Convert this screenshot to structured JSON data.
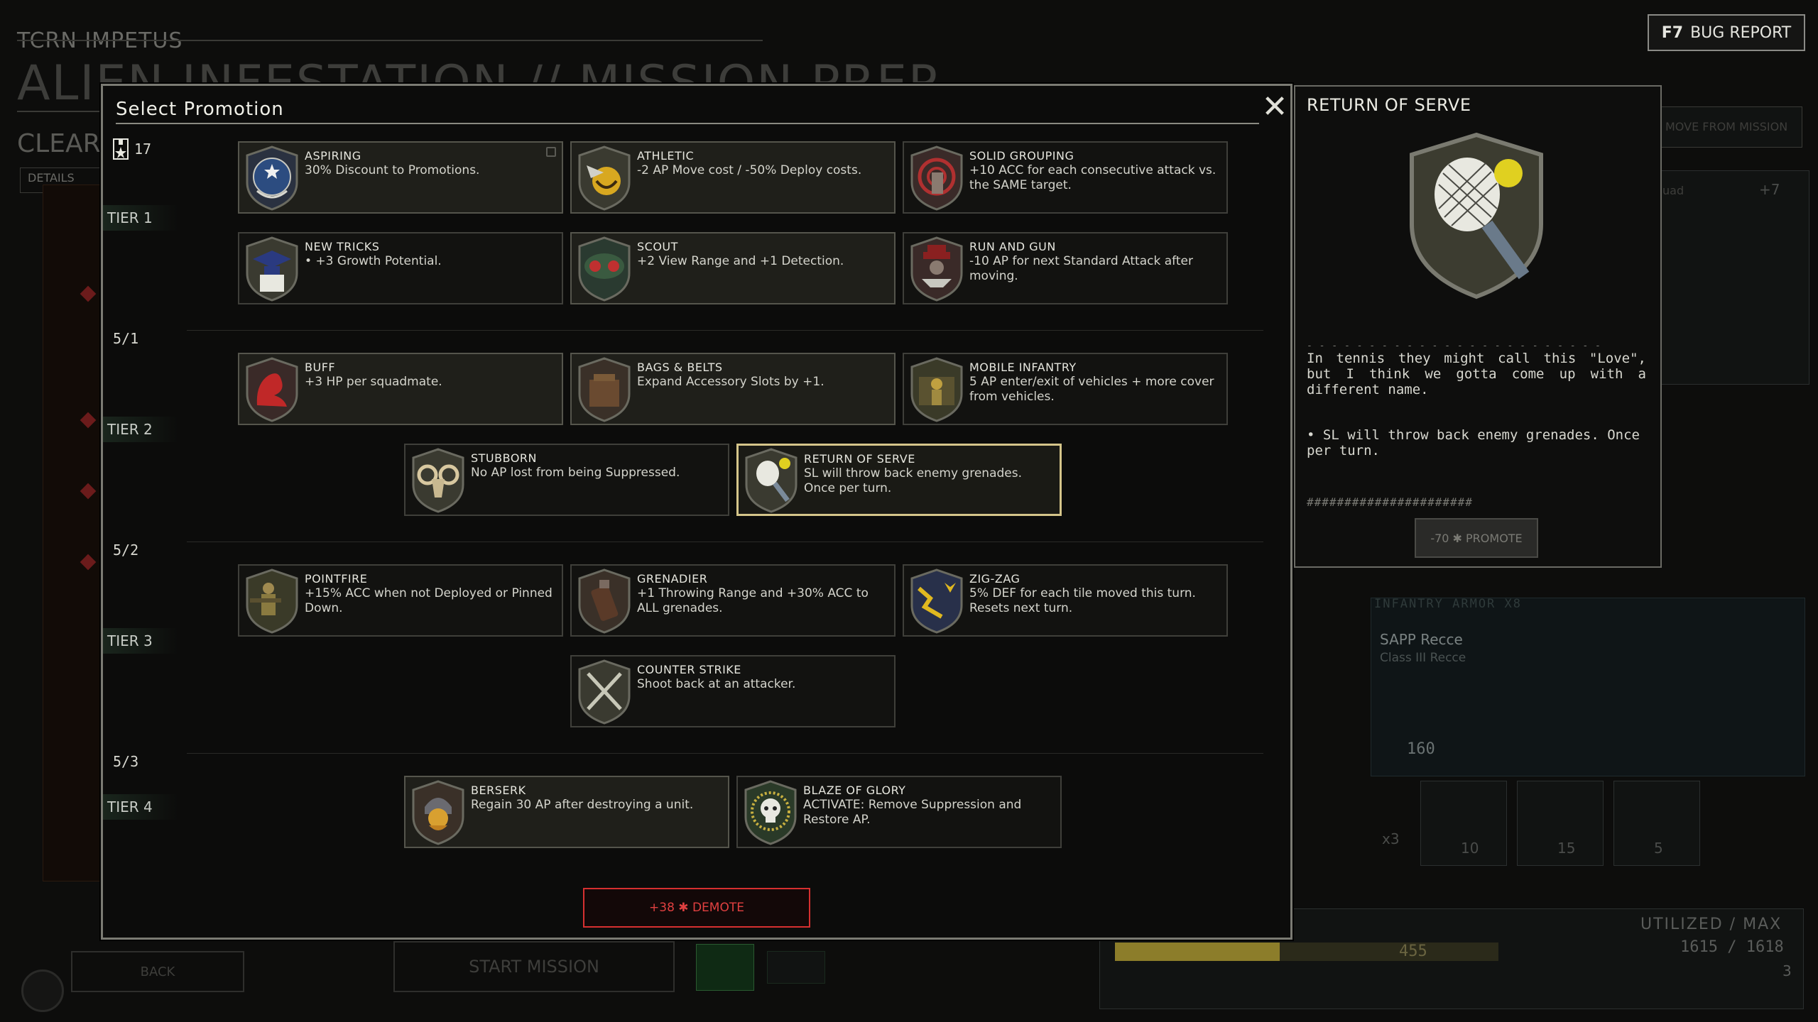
{
  "background": {
    "ship_name": "TCRN IMPETUS",
    "screen_title": "ALIEN INFESTATION // MISSION PREP",
    "clear_label": "CLEAR",
    "details_label": "DETAILS",
    "bug_report_key": "F7",
    "bug_report_label": "BUG REPORT",
    "remove_from_mission": "MOVE FROM MISSION",
    "squad_label": "uad",
    "squad_count": "+7",
    "armor_header": "INFANTRY ARMOR X8",
    "armor_name": "SAPP Recce",
    "armor_class": "Class III Recce",
    "armor_cost": "160",
    "item_costs": [
      "10",
      "15",
      "5"
    ],
    "x3_label": "x3",
    "utilized_label": "UTILIZED / MAX",
    "utilized_value": "1615 / 1618",
    "extra_value": "3",
    "bar_value": "455",
    "bar_fraction": 0.43,
    "back_label": "BACK",
    "start_mission_label": "START MISSION"
  },
  "modal": {
    "title": "Select Promotion",
    "close_label": "✕",
    "medal_count": "17",
    "tiers": {
      "tier1": "TIER 1",
      "tier2": "TIER 2",
      "tier3": "TIER 3",
      "tier4": "TIER 4"
    },
    "ranks": {
      "r1": "5/1",
      "r2": "5/2",
      "r3": "5/3"
    },
    "perks": {
      "aspiring": {
        "name": "ASPIRING",
        "desc": "30% Discount to Promotions."
      },
      "athletic": {
        "name": "ATHLETIC",
        "desc": "-2 AP Move cost / -50% Deploy costs."
      },
      "solid_grouping": {
        "name": "SOLID GROUPING",
        "desc": "+10 ACC for each consecutive attack vs. the SAME target."
      },
      "new_tricks": {
        "name": "NEW TRICKS",
        "desc": "• +3 Growth Potential."
      },
      "scout": {
        "name": "SCOUT",
        "desc": "+2 View Range and +1 Detection."
      },
      "run_and_gun": {
        "name": "RUN AND GUN",
        "desc": "-10 AP for next Standard Attack after moving."
      },
      "buff": {
        "name": "BUFF",
        "desc": "+3 HP per squadmate."
      },
      "bags_belts": {
        "name": "BAGS & BELTS",
        "desc": "Expand Accessory Slots by +1."
      },
      "mobile_infantry": {
        "name": "MOBILE INFANTRY",
        "desc": "5 AP enter/exit of vehicles + more cover from vehicles."
      },
      "stubborn": {
        "name": "STUBBORN",
        "desc": "No AP lost from being Suppressed."
      },
      "return_of_serve": {
        "name": "RETURN OF SERVE",
        "desc": "SL will throw back enemy grenades. Once per turn."
      },
      "pointfire": {
        "name": "POINTFIRE",
        "desc": "+15% ACC when not Deployed or Pinned Down."
      },
      "grenadier": {
        "name": "GRENADIER",
        "desc": "+1 Throwing Range and +30% ACC to ALL grenades."
      },
      "zig_zag": {
        "name": "ZIG-ZAG",
        "desc": "5% DEF for each tile moved this turn. Resets next turn."
      },
      "counter_strike": {
        "name": "COUNTER STRIKE",
        "desc": "Shoot back at an attacker."
      },
      "berserk": {
        "name": "BERSERK",
        "desc": "Regain 30 AP after destroying a unit."
      },
      "blaze_of_glory": {
        "name": "BLAZE OF GLORY",
        "desc": "ACTIVATE: Remove Suppression and Restore AP."
      }
    },
    "demote_label": "+38 ✱ DEMOTE"
  },
  "detail": {
    "title": "RETURN OF SERVE",
    "dashes": "- - - - - - - - - - - - - - - - - - - - - - - -",
    "flavor": "In tennis they might call this \"Love\", but I think we gotta come up with a different name.",
    "effect": "• SL will throw back enemy grenades. Once per turn.",
    "hashes": "######################",
    "promote_label": "-70 ✱ PROMOTE"
  },
  "colors": {
    "accent_gold": "#d5c58a",
    "demote_red": "#d63030",
    "tier_green": "#1a261d"
  }
}
